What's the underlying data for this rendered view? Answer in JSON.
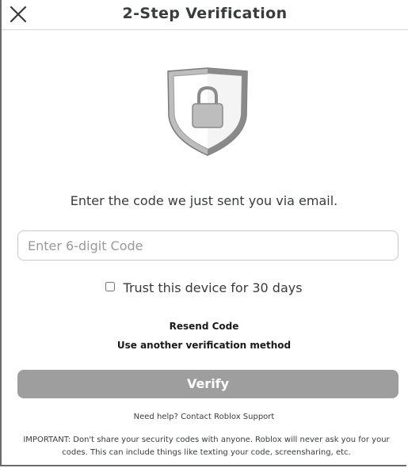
{
  "dialog": {
    "title": "2-Step Verification",
    "close_icon": "close-icon"
  },
  "shield": {
    "icon": "shield-lock-icon",
    "colors": {
      "outer_light": "#bdbdbd",
      "outer_dark": "#8a8a8a",
      "inner": "#ffffff",
      "lock": "#bdbdbd",
      "lock_stroke": "#8a8a8a"
    }
  },
  "instruction": "Enter the code we just sent you via email.",
  "code_field": {
    "placeholder": "Enter 6-digit Code",
    "value": ""
  },
  "trust_device": {
    "label": "Trust this device for 30 days",
    "checked": false
  },
  "links": {
    "resend": "Resend Code",
    "another_method": "Use another verification method"
  },
  "verify_button": {
    "label": "Verify",
    "color": "#9e9e9e",
    "enabled": false
  },
  "help": {
    "prefix": "Need help? ",
    "link": "Contact Roblox Support"
  },
  "important_notice": "IMPORTANT: Don't share your security codes with anyone. Roblox will never ask you for your codes. This can include things like texting your code, screensharing, etc."
}
